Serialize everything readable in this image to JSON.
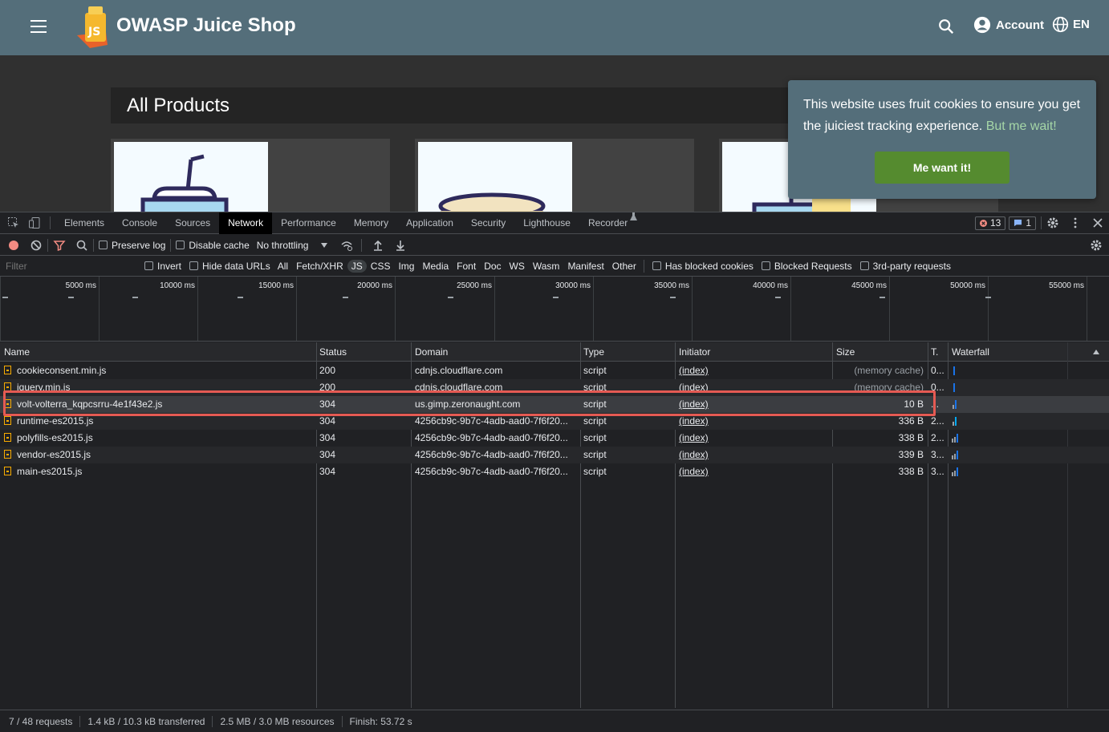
{
  "app": {
    "title": "OWASP Juice Shop",
    "account_label": "Account",
    "language_label": "EN",
    "products_title": "All Products",
    "brand_color": "#546e7a"
  },
  "cookie": {
    "message": "This website uses fruit cookies to ensure you get the juiciest tracking experience.",
    "link": "But me wait!",
    "button": "Me want it!"
  },
  "devtools": {
    "tabs": [
      "Elements",
      "Console",
      "Sources",
      "Network",
      "Performance",
      "Memory",
      "Application",
      "Security",
      "Lighthouse",
      "Recorder"
    ],
    "active_tab": "Network",
    "error_count": "13",
    "message_count": "1",
    "toolbar": {
      "preserve_log": "Preserve log",
      "disable_cache": "Disable cache",
      "throttling": "No throttling"
    },
    "filter": {
      "placeholder": "Filter",
      "invert": "Invert",
      "hide_data_urls": "Hide data URLs",
      "types": [
        "All",
        "Fetch/XHR",
        "JS",
        "CSS",
        "Img",
        "Media",
        "Font",
        "Doc",
        "WS",
        "Wasm",
        "Manifest",
        "Other"
      ],
      "active_type": "JS",
      "has_blocked_cookies": "Has blocked cookies",
      "blocked_requests": "Blocked Requests",
      "third_party": "3rd-party requests"
    },
    "timeline_labels": [
      "5000 ms",
      "10000 ms",
      "15000 ms",
      "20000 ms",
      "25000 ms",
      "30000 ms",
      "35000 ms",
      "40000 ms",
      "45000 ms",
      "50000 ms",
      "55000 ms"
    ],
    "columns": {
      "name": "Name",
      "status": "Status",
      "domain": "Domain",
      "type": "Type",
      "initiator": "Initiator",
      "size": "Size",
      "time": "T.",
      "waterfall": "Waterfall"
    },
    "requests": [
      {
        "name": "cookieconsent.min.js",
        "status": "200",
        "domain": "cdnjs.cloudflare.com",
        "type": "script",
        "initiator": "(index)",
        "size": "(memory cache)",
        "time": "0..."
      },
      {
        "name": "jquery.min.js",
        "status": "200",
        "domain": "cdnjs.cloudflare.com",
        "type": "script",
        "initiator": "(index)",
        "size": "(memory cache)",
        "time": "0..."
      },
      {
        "name": "volt-volterra_kqpcsrru-4e1f43e2.js",
        "status": "304",
        "domain": "us.gimp.zeronaught.com",
        "type": "script",
        "initiator": "(index)",
        "size": "10 B",
        "time": "..."
      },
      {
        "name": "runtime-es2015.js",
        "status": "304",
        "domain": "4256cb9c-9b7c-4adb-aad0-7f6f20...",
        "type": "script",
        "initiator": "(index)",
        "size": "336 B",
        "time": "2..."
      },
      {
        "name": "polyfills-es2015.js",
        "status": "304",
        "domain": "4256cb9c-9b7c-4adb-aad0-7f6f20...",
        "type": "script",
        "initiator": "(index)",
        "size": "338 B",
        "time": "2..."
      },
      {
        "name": "vendor-es2015.js",
        "status": "304",
        "domain": "4256cb9c-9b7c-4adb-aad0-7f6f20...",
        "type": "script",
        "initiator": "(index)",
        "size": "339 B",
        "time": "3..."
      },
      {
        "name": "main-es2015.js",
        "status": "304",
        "domain": "4256cb9c-9b7c-4adb-aad0-7f6f20...",
        "type": "script",
        "initiator": "(index)",
        "size": "338 B",
        "time": "3..."
      }
    ],
    "selected_request": "volt-volterra_kqpcsrru-4e1f43e2.js",
    "highlight_color": "#e55a53",
    "status": {
      "requests": "7 / 48 requests",
      "transferred": "1.4 kB / 10.3 kB transferred",
      "resources": "2.5 MB / 3.0 MB resources",
      "finish": "Finish: 53.72 s"
    }
  }
}
